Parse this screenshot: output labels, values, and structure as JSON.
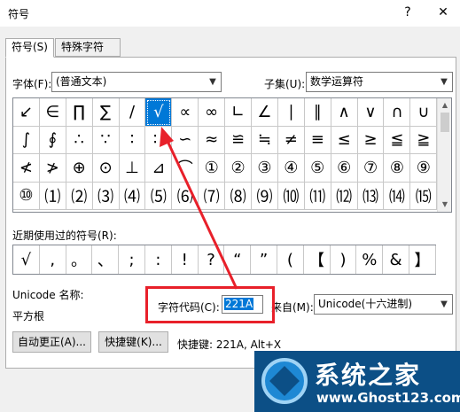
{
  "window": {
    "title": "符号",
    "help_label": "?",
    "close_label": "✕"
  },
  "tabs": [
    {
      "label": "符号(S)",
      "active": true
    },
    {
      "label": "特殊字符(P)",
      "active": false
    }
  ],
  "font": {
    "label": "字体(F):",
    "value": "(普通文本)"
  },
  "subset": {
    "label": "子集(U):",
    "value": "数学运算符"
  },
  "symbols": [
    [
      "↙",
      "∈",
      "∏",
      "∑",
      "∕",
      "√",
      "∝",
      "∞",
      "∟",
      "∠",
      "∣",
      "∥",
      "∧",
      "∨",
      "∩",
      "∪"
    ],
    [
      "∫",
      "∮",
      "∴",
      "∵",
      "∶",
      "∷",
      "∽",
      "≈",
      "≌",
      "≒",
      "≠",
      "≡",
      "≤",
      "≥",
      "≦",
      "≧"
    ],
    [
      "≮",
      "≯",
      "⊕",
      "⊙",
      "⊥",
      "⊿",
      "⌒",
      "①",
      "②",
      "③",
      "④",
      "⑤",
      "⑥",
      "⑦",
      "⑧",
      "⑨"
    ],
    [
      "⑩",
      "⑴",
      "⑵",
      "⑶",
      "⑷",
      "⑸",
      "⑹",
      "⑺",
      "⑻",
      "⑼",
      "⑽",
      "⑾",
      "⑿",
      "⒀",
      "⒁",
      "⒂"
    ]
  ],
  "selected_symbol": "√",
  "recent": {
    "label": "近期使用过的符号(R):",
    "items": [
      "√",
      ",",
      "。",
      "、",
      ";",
      ":",
      "!",
      "?",
      "“",
      "”",
      "(",
      "【",
      ")",
      "%",
      "&",
      "】"
    ]
  },
  "unicode_name": {
    "label": "Unicode 名称:",
    "value": "平方根"
  },
  "char_code": {
    "label": "字符代码(C):",
    "value": "221A"
  },
  "from": {
    "label": "来自(M):",
    "value": "Unicode(十六进制)"
  },
  "buttons": {
    "autocorrect": "自动更正(A)...",
    "shortcut_key": "快捷键(K)..."
  },
  "shortcut_text": "快捷键: 221A, Alt+X",
  "watermark": {
    "title": "系统之家",
    "url": "www.Ghost123.com"
  },
  "colors": {
    "accent": "#0078d7",
    "annotation_red": "#e8202a",
    "watermark_bg": "#0c4f86"
  }
}
